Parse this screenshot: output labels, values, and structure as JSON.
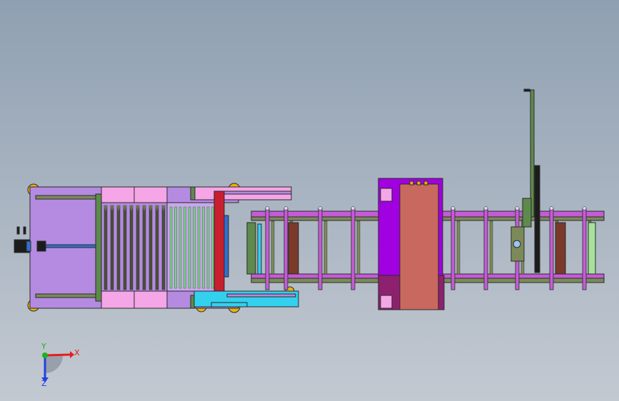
{
  "viewport": {
    "background_top": "#8fa0b2",
    "background_bottom": "#c3c9d1"
  },
  "triad": {
    "x_label": "X",
    "y_label": "Y",
    "z_label": "Z",
    "x_color": "#e02020",
    "y_color": "#20b020",
    "z_color": "#2040e0"
  },
  "colors": {
    "outline": "#2a2a2a",
    "lavender": "#b48be0",
    "pink": "#f4a6e6",
    "magenta_rail": "#c45cd6",
    "purple_box": "#a100e0",
    "salmon": "#c9685f",
    "red": "#c81e2e",
    "cyan": "#33d1ee",
    "green": "#5e8a4c",
    "olive": "#7c8a5a",
    "brown": "#7a3a2a",
    "lime": "#a6e39a",
    "blue": "#3070d0",
    "dark": "#1c1c1c",
    "yellow": "#e8b20e"
  }
}
